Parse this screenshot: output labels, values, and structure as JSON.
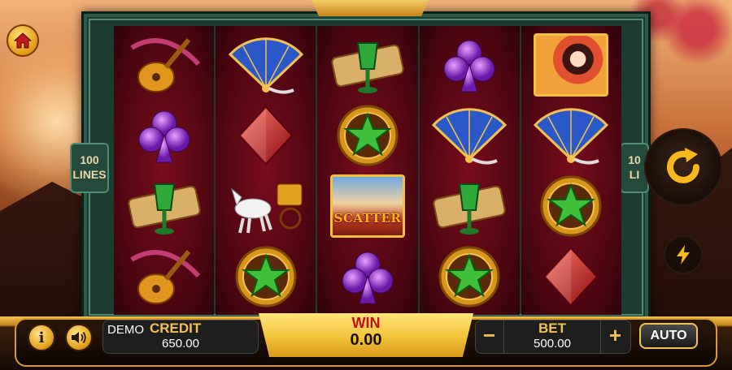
{
  "game": {
    "lines_left": "100",
    "lines_left_unit": "LINES",
    "lines_right": "10",
    "lines_right_unit": "LI"
  },
  "reels": [
    [
      "pipa-lute",
      "purple-club",
      "jade-goblet-scroll",
      "pipa-lute"
    ],
    [
      "fan",
      "red-diamond",
      "horse-chariot",
      "green-star-medallion"
    ],
    [
      "jade-goblet-scroll",
      "green-star-medallion",
      "scatter",
      "purple-club"
    ],
    [
      "purple-club",
      "fan",
      "jade-goblet-scroll",
      "green-star-medallion"
    ],
    [
      "lady",
      "fan",
      "green-star-medallion",
      "red-diamond"
    ]
  ],
  "scatter_label": "SCATTER",
  "bottom_bar": {
    "demo_label": "DEMO",
    "credit_label": "CREDIT",
    "credit_value": "650.00",
    "win_label": "WIN",
    "win_value": "0.00",
    "bet_label": "BET",
    "bet_value": "500.00",
    "bet_minus": "−",
    "bet_plus": "+",
    "auto_label": "AUTO",
    "info_label": "i"
  },
  "colors": {
    "gold": "#f3c24e",
    "reel_red": "#7a0c1c",
    "frame_green": "#1d3b30",
    "win_text": "#c01010"
  }
}
